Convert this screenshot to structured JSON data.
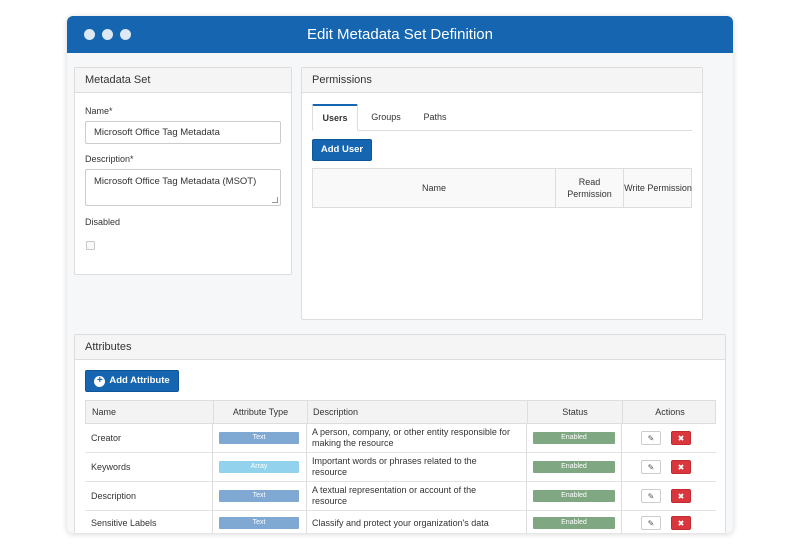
{
  "window": {
    "title": "Edit Metadata Set Definition"
  },
  "metadata_set": {
    "heading": "Metadata Set",
    "name_label": "Name*",
    "name_value": "Microsoft Office Tag Metadata",
    "description_label": "Description*",
    "description_value": "Microsoft Office Tag Metadata (MSOT)",
    "disabled_label": "Disabled"
  },
  "permissions": {
    "heading": "Permissions",
    "tabs": [
      {
        "label": "Users",
        "active": true
      },
      {
        "label": "Groups",
        "active": false
      },
      {
        "label": "Paths",
        "active": false
      }
    ],
    "add_user_label": "Add User",
    "columns": {
      "name": "Name",
      "read": "Read Permission",
      "write": "Write Permission"
    }
  },
  "attributes": {
    "heading": "Attributes",
    "add_label": "Add Attribute",
    "columns": {
      "name": "Name",
      "type": "Attribute Type",
      "description": "Description",
      "status": "Status",
      "actions": "Actions"
    },
    "rows": [
      {
        "name": "Creator",
        "type": "Text",
        "description": "A person, company, or other entity responsible for making the resource",
        "status": "Enabled"
      },
      {
        "name": "Keywords",
        "type": "Array",
        "description": "Important words or phrases related to the resource",
        "status": "Enabled"
      },
      {
        "name": "Description",
        "type": "Text",
        "description": "A textual representation or account of the resource",
        "status": "Enabled"
      },
      {
        "name": "Sensitive Labels",
        "type": "Text",
        "description": "Classify and protect your organization's data",
        "status": "Enabled"
      }
    ]
  },
  "colors": {
    "title_bar": "#1565b0",
    "primary_button": "#1565b0",
    "type_text": "#7fa8d3",
    "type_array": "#93d2ec",
    "status_enabled": "#7fa882",
    "delete_button": "#d9363e"
  },
  "icons": {
    "window_controls": "dots",
    "add_attribute": "plus-circle-icon",
    "edit": "edit-icon",
    "delete": "close-icon"
  }
}
